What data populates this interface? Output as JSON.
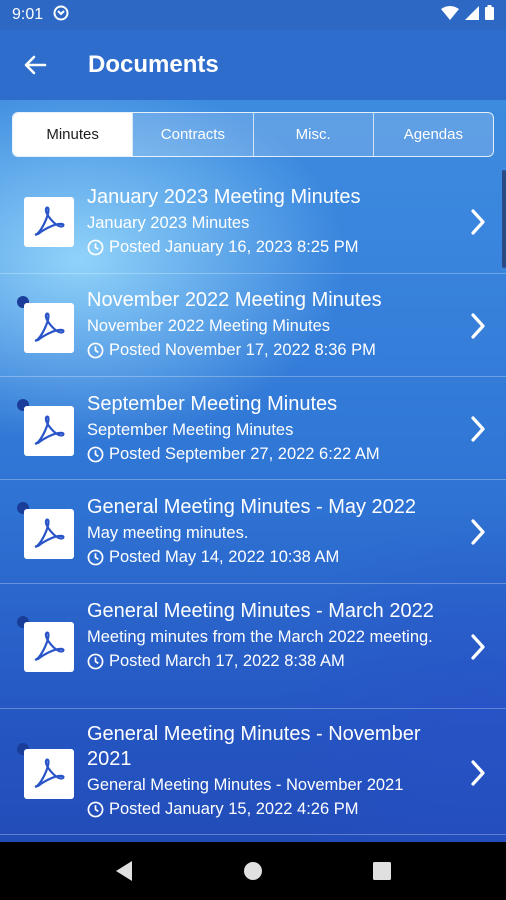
{
  "status_bar": {
    "time": "9:01"
  },
  "header": {
    "title": "Documents"
  },
  "tabs": [
    {
      "label": "Minutes",
      "active": true
    },
    {
      "label": "Contracts",
      "active": false
    },
    {
      "label": "Misc.",
      "active": false
    },
    {
      "label": "Agendas",
      "active": false
    }
  ],
  "documents": [
    {
      "title": "January 2023 Meeting Minutes",
      "subtitle": "January 2023 Minutes",
      "posted": "Posted January 16, 2023 8:25 PM",
      "unread": false
    },
    {
      "title": "November 2022 Meeting Minutes",
      "subtitle": "November 2022 Meeting Minutes",
      "posted": "Posted November 17, 2022 8:36 PM",
      "unread": true
    },
    {
      "title": "September Meeting Minutes",
      "subtitle": "September Meeting Minutes",
      "posted": "Posted September 27, 2022 6:22 AM",
      "unread": true
    },
    {
      "title": "General Meeting Minutes - May 2022",
      "subtitle": "May meeting minutes.",
      "posted": "Posted May 14, 2022 10:38 AM",
      "unread": true
    },
    {
      "title": "General Meeting Minutes - March 2022",
      "subtitle": "Meeting minutes from the March 2022 meeting.",
      "posted": "Posted March 17, 2022 8:38 AM",
      "unread": true
    },
    {
      "title": "General Meeting Minutes - November 2021",
      "subtitle": "General Meeting Minutes - November 2021",
      "posted": "Posted January 15, 2022 4:26 PM",
      "unread": true
    }
  ],
  "colors": {
    "accent": "#2f6dcc",
    "unread_dot": "#1a3d9a"
  },
  "icons": [
    "back-arrow-icon",
    "pdf-icon",
    "clock-icon",
    "chevron-right-icon",
    "wifi-icon",
    "signal-icon",
    "battery-icon"
  ]
}
